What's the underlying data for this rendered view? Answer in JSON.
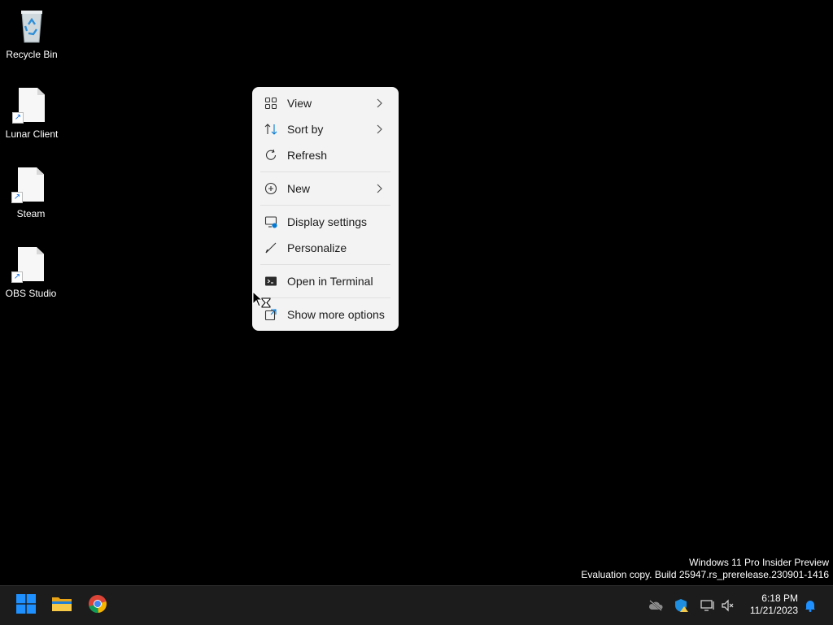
{
  "desktop": {
    "icons": [
      {
        "label": "Recycle Bin",
        "icon": "recycle-bin-icon"
      },
      {
        "label": "Lunar Client",
        "icon": "file-shortcut-icon"
      },
      {
        "label": "Steam",
        "icon": "file-shortcut-icon"
      },
      {
        "label": "OBS Studio",
        "icon": "file-shortcut-icon"
      }
    ]
  },
  "context_menu": {
    "items": [
      {
        "label": "View",
        "icon": "view-grid-icon",
        "submenu": true
      },
      {
        "label": "Sort by",
        "icon": "sort-icon",
        "submenu": true
      },
      {
        "label": "Refresh",
        "icon": "refresh-icon",
        "submenu": false
      },
      {
        "label": "New",
        "icon": "plus-circle-icon",
        "submenu": true
      },
      {
        "label": "Display settings",
        "icon": "display-settings-icon",
        "submenu": false
      },
      {
        "label": "Personalize",
        "icon": "brush-icon",
        "submenu": false
      },
      {
        "label": "Open in Terminal",
        "icon": "terminal-icon",
        "submenu": false
      },
      {
        "label": "Show more options",
        "icon": "show-more-icon",
        "submenu": false
      }
    ]
  },
  "watermark": {
    "line1": "Windows 11 Pro Insider Preview",
    "line2": "Evaluation copy. Build 25947.rs_prerelease.230901-1416"
  },
  "taskbar": {
    "pinned": [
      {
        "name": "start-button",
        "icon": "windows-logo-icon"
      },
      {
        "name": "file-explorer-button",
        "icon": "folder-icon"
      },
      {
        "name": "chrome-button",
        "icon": "chrome-icon"
      }
    ],
    "tray": [
      {
        "name": "onedrive-icon"
      },
      {
        "name": "security-warning-icon"
      },
      {
        "name": "network-icon"
      },
      {
        "name": "volume-muted-icon"
      }
    ],
    "clock": {
      "time": "6:18 PM",
      "date": "11/21/2023"
    }
  },
  "colors": {
    "accent": "#0078d4",
    "menu_bg": "#f3f3f3",
    "taskbar_bg": "#1c1c1c"
  }
}
